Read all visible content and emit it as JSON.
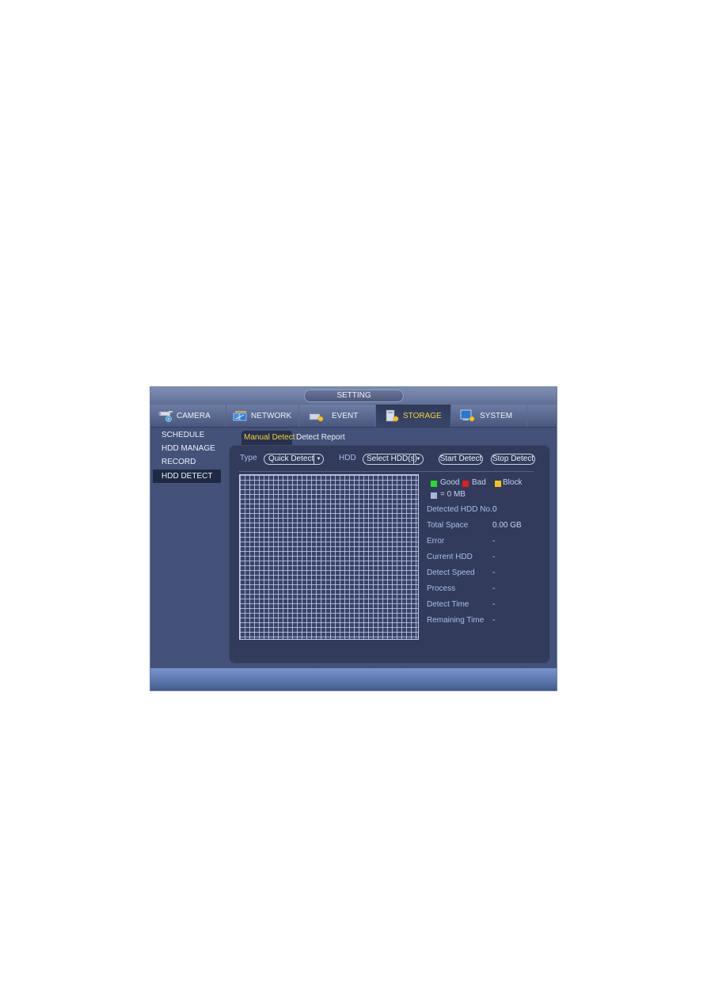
{
  "window": {
    "title": "SETTING"
  },
  "tabs": [
    {
      "label": "CAMERA",
      "icon": "camera-icon",
      "active": false
    },
    {
      "label": "NETWORK",
      "icon": "network-icon",
      "active": false
    },
    {
      "label": "EVENT",
      "icon": "event-icon",
      "active": false
    },
    {
      "label": "STORAGE",
      "icon": "storage-icon",
      "active": true
    },
    {
      "label": "SYSTEM",
      "icon": "system-icon",
      "active": false
    }
  ],
  "sidebar": {
    "items": [
      {
        "label": "SCHEDULE",
        "active": false
      },
      {
        "label": "HDD MANAGE",
        "active": false
      },
      {
        "label": "RECORD",
        "active": false
      },
      {
        "label": "HDD DETECT",
        "active": true
      }
    ]
  },
  "subtabs": [
    {
      "label": "Manual Detect",
      "active": true
    },
    {
      "label": "Detect Report",
      "active": false
    }
  ],
  "controls": {
    "type_label": "Type",
    "type_value": "Quick Detect",
    "hdd_label": "HDD",
    "hdd_value": "Select HDD(s)",
    "start_label": "Start Detect",
    "stop_label": "Stop Detect"
  },
  "legend": {
    "good": {
      "label": "Good",
      "color": "#22e022"
    },
    "bad": {
      "label": "Bad",
      "color": "#e01c1c"
    },
    "block": {
      "label": "Block",
      "color": "#f2c318"
    },
    "unit": {
      "label": "= 0 MB",
      "color": "#a9b6dc"
    }
  },
  "info": [
    {
      "label": "Detected HDD No.",
      "value": "0"
    },
    {
      "label": "Total Space",
      "value": "0.00 GB"
    },
    {
      "label": "Error",
      "value": "-"
    },
    {
      "label": "Current HDD",
      "value": "-"
    },
    {
      "label": "Detect Speed",
      "value": "-"
    },
    {
      "label": "Process",
      "value": "-"
    },
    {
      "label": "Detect Time",
      "value": "-"
    },
    {
      "label": "Remaining Time",
      "value": "-"
    }
  ],
  "colors": {
    "accent": "#f4d33a",
    "panel": "#323b5b",
    "window": "#44527a"
  }
}
